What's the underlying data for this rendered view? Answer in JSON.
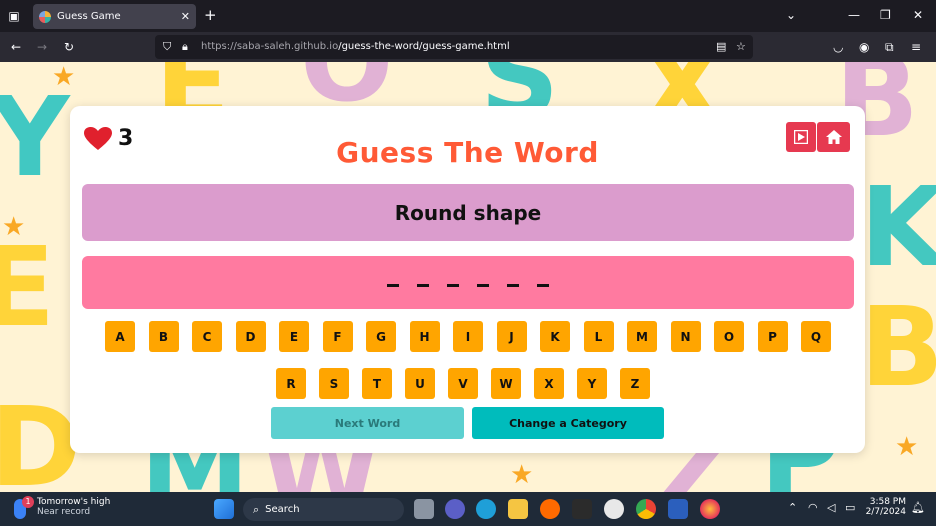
{
  "browser": {
    "tab_title": "Guess Game",
    "url_host": "https://saba-saleh.github.io",
    "url_path": "/guess-the-word/guess-game.html"
  },
  "game": {
    "lives": "3",
    "title": "Guess The Word",
    "hint": "Round shape",
    "word_blanks": 6,
    "keys_row1": [
      "A",
      "B",
      "C",
      "D",
      "E",
      "F",
      "G",
      "H",
      "I",
      "J",
      "K",
      "L",
      "M",
      "N",
      "O",
      "P",
      "Q"
    ],
    "keys_row2": [
      "R",
      "S",
      "T",
      "U",
      "V",
      "W",
      "X",
      "Y",
      "Z"
    ],
    "next_word_label": "Next Word",
    "change_category_label": "Change a Category"
  },
  "taskbar": {
    "weather_title": "Tomorrow's high",
    "weather_sub": "Near record",
    "weather_badge": "1",
    "search_label": "Search",
    "time": "3:58 PM",
    "date": "2/7/2024"
  },
  "colors": {
    "title": "#ff5a36",
    "hint_bg": "#db9ccd",
    "word_bg": "#ff7aa0",
    "key_bg": "#ffa500",
    "next_word_bg": "#5cd0d0",
    "change_category_bg": "#00bcbc",
    "top_buttons": "#e63950"
  }
}
